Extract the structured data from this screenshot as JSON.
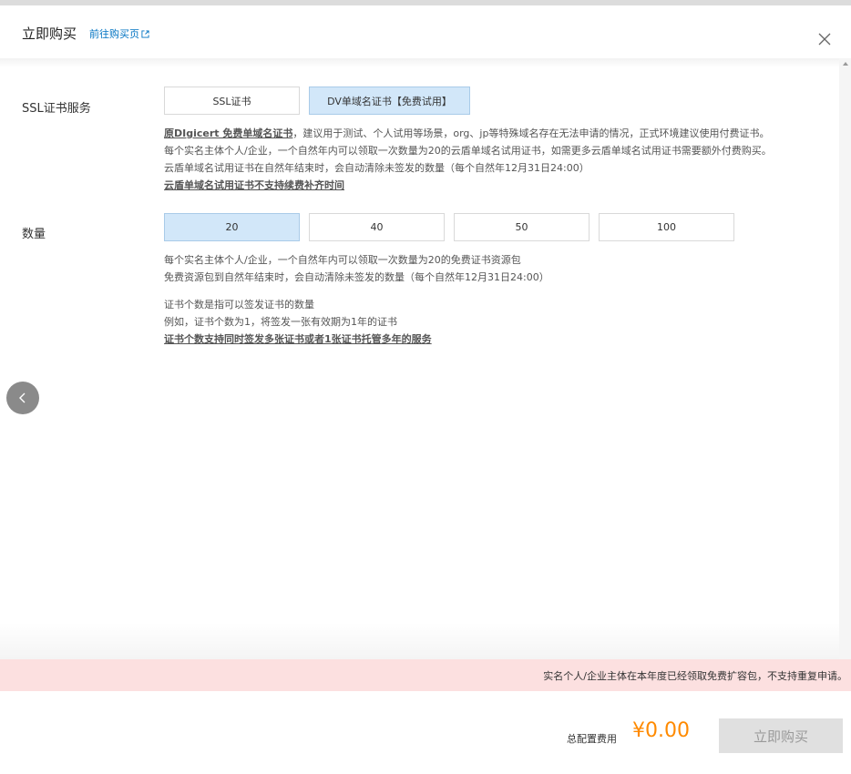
{
  "header": {
    "title": "立即购买",
    "link_label": "前往购买页",
    "close_icon": "close-icon",
    "external_icon": "external-link-icon"
  },
  "ssl_service": {
    "label": "SSL证书服务",
    "options": [
      "SSL证书",
      "DV单域名证书【免费试用】"
    ],
    "selected": "DV单域名证书【免费试用】",
    "desc_bold_1": "原DIgicert 免费单域名证书",
    "desc_line_1": "，建议用于测试、个人试用等场景，org、jp等特殊域名存在无法申请的情况，正式环境建议使用付费证书。",
    "desc_line_2": "每个实名主体个人/企业，一个自然年内可以领取一次数量为20的云盾单域名试用证书，如需更多云盾单域名试用证书需要额外付费购买。",
    "desc_line_3": "云盾单域名试用证书在自然年结束时，会自动清除未签发的数量（每个自然年12月31日24:00）",
    "desc_bold_2": "云盾单域名试用证书不支持续费补齐时间"
  },
  "quantity": {
    "label": "数量",
    "options": [
      "20",
      "40",
      "50",
      "100"
    ],
    "selected": "20",
    "desc_line_1": "每个实名主体个人/企业，一个自然年内可以领取一次数量为20的免费证书资源包",
    "desc_line_2": "免费资源包到自然年结束时，会自动清除未签发的数量（每个自然年12月31日24:00）",
    "desc_line_3": "证书个数是指可以签发证书的数量",
    "desc_line_4": "例如，证书个数为1，将签发一张有效期为1年的证书",
    "desc_bold": "证书个数支持同时签发多张证书或者1张证书托管多年的服务"
  },
  "notice": "实名个人/企业主体在本年度已经领取免费扩容包，不支持重复申请。",
  "footer": {
    "fee_label": "总配置费用",
    "fee_amount": "¥0.00",
    "buy_label": "立即购买"
  },
  "icons": {
    "back": "chevron-left-icon",
    "scroll_up": "scroll-up-arrow-icon"
  },
  "colors": {
    "accent_link": "#0073c2",
    "selected_bg": "#d2e7f9",
    "price": "#ff8a00",
    "notice_bg": "#fce0e0",
    "disabled_button_bg": "#e0e0e0"
  }
}
